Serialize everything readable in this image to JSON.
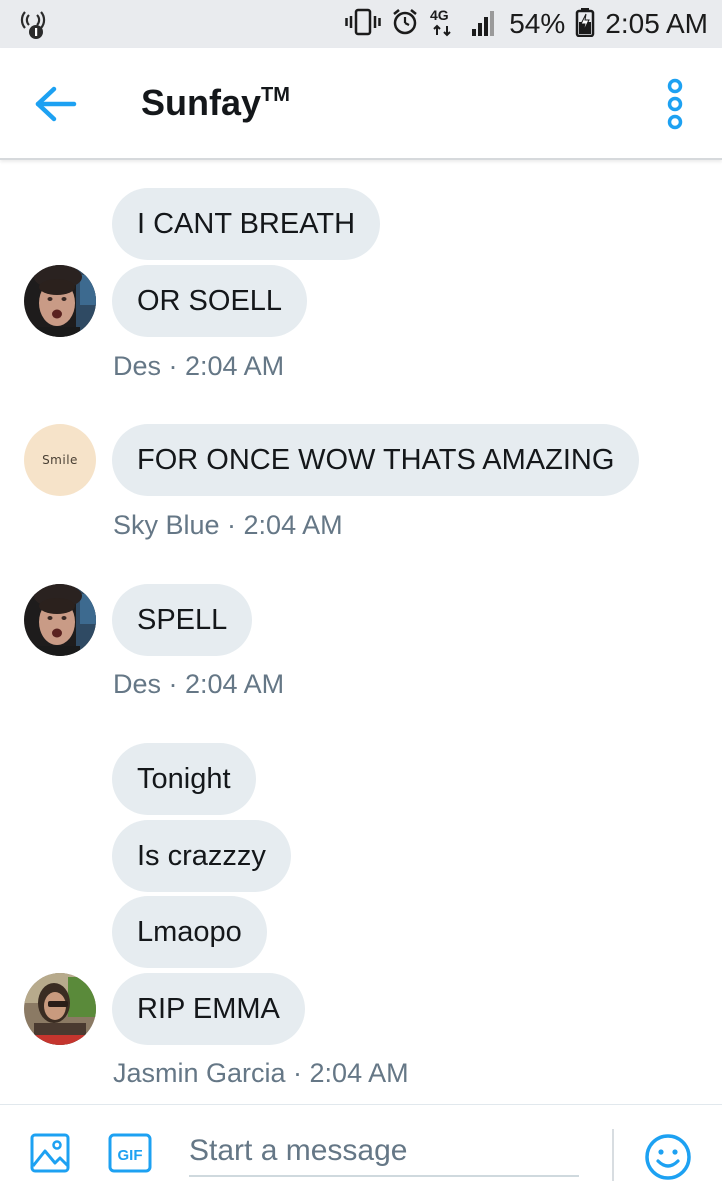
{
  "status_bar": {
    "battery": "54%",
    "time": "2:05 AM",
    "network": "4G",
    "icons": [
      "wifi-calling-icon",
      "vibrate-icon",
      "alarm-icon",
      "network-4g-icon",
      "signal-icon",
      "battery-icon"
    ]
  },
  "header": {
    "title": "Sunfay",
    "title_mark": "TM",
    "icons": [
      "back-arrow-icon",
      "more-options-icon"
    ]
  },
  "messages": [
    {
      "bubbles": [
        "I CANT BREATH",
        "OR SOELL"
      ],
      "sender": "Des",
      "time": "2:04 AM",
      "meta": "Des · 2:04 AM"
    },
    {
      "bubbles": [
        "FOR ONCE WOW THATS AMAZING"
      ],
      "sender": "Sky Blue",
      "time": "2:04 AM",
      "meta": "Sky Blue · 2:04 AM",
      "avatar_text": "Smile"
    },
    {
      "bubbles": [
        "SPELL"
      ],
      "sender": "Des",
      "time": "2:04 AM",
      "meta": "Des · 2:04 AM"
    },
    {
      "bubbles": [
        "Tonight",
        "Is crazzzy",
        "Lmaopo",
        "RIP EMMA"
      ],
      "sender": "Jasmin Garcia",
      "time": "2:04 AM",
      "meta": "Jasmin Garcia · 2:04 AM"
    }
  ],
  "composer": {
    "placeholder": "Start a message",
    "gif_label": "GIF",
    "icons": [
      "image-icon",
      "gif-icon",
      "emoji-icon"
    ]
  },
  "colors": {
    "accent": "#1da1f2",
    "bubble": "#e6ecf0",
    "meta_text": "#657786",
    "status_bar": "#e9ebee"
  }
}
